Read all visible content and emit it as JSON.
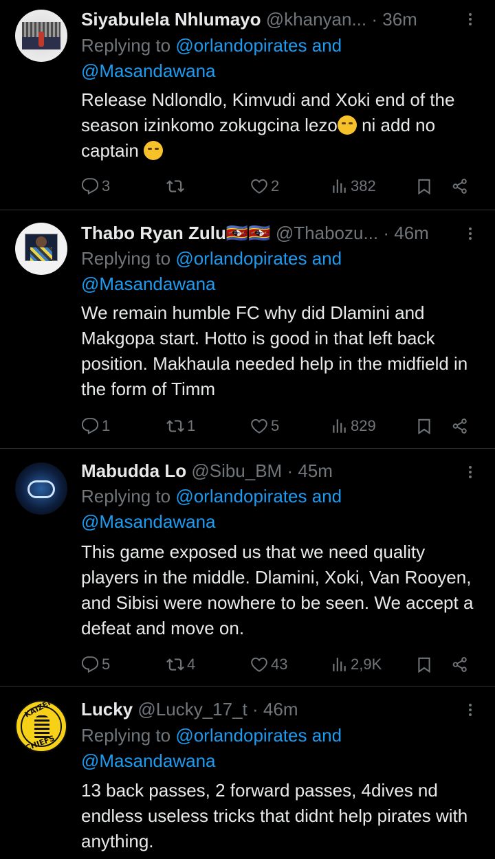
{
  "replying_prefix": "Replying to",
  "tweets": [
    {
      "name": "Siyabulela Nhlumayo",
      "handle": "@khanyan...",
      "time": "· 36m",
      "reply_links": "@orlandopirates and",
      "reply_links2": "@Masandawana",
      "body_a": "Release Ndlondlo, Kimvudi and Xoki end of the season izinkomo zokugcina lezo",
      "body_b": " ni add no captain ",
      "replies": "3",
      "reposts": "",
      "likes": "2",
      "views": "382"
    },
    {
      "name": "Thabo Ryan Zulu🇸🇿🇸🇿",
      "handle": "@Thabozu...",
      "time": "· 46m",
      "reply_links": "@orlandopirates and",
      "reply_links2": "@Masandawana",
      "body": "We remain humble FC why did Dlamini and Makgopa start. Hotto is good in that left back position. Makhaula needed help in the midfield in the form of Timm",
      "replies": "1",
      "reposts": "1",
      "likes": "5",
      "views": "829"
    },
    {
      "name": "Mabudda Lo",
      "handle": "@Sibu_BM",
      "time": "· 45m",
      "reply_links": "@orlandopirates and",
      "reply_links2": "@Masandawana",
      "body": "This game exposed us that we need quality players in the middle. Dlamini, Xoki, Van Rooyen, and Sibisi were nowhere to be seen. We accept a defeat and move on.",
      "replies": "5",
      "reposts": "4",
      "likes": "43",
      "views": "2,9K"
    },
    {
      "name": "Lucky",
      "handle": "@Lucky_17_t",
      "time": "· 46m",
      "reply_links": "@orlandopirates and",
      "reply_links2": "@Masandawana",
      "body": "13 back passes, 2 forward passes, 4dives nd endless useless tricks that didnt help pirates with anything.",
      "avatar_text_top": "KAIZER",
      "avatar_text_bottom": "CHIEFS"
    }
  ]
}
